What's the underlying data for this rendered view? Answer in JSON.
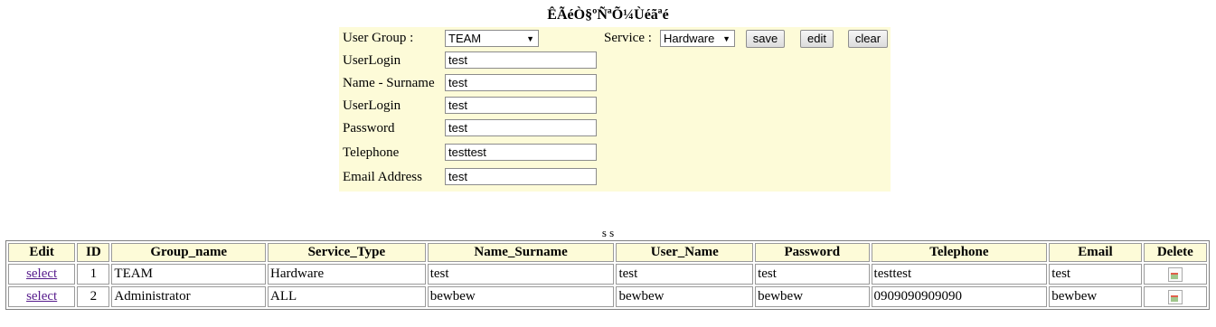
{
  "page_title": "ÊÃéÒ§ºÑªÕ¼Ùéãªé",
  "form": {
    "user_group_label": "User Group :",
    "user_group_value": "TEAM",
    "service_label": "Service :",
    "service_value": "Hardware",
    "buttons": {
      "save": "save",
      "edit": "edit",
      "clear": "clear"
    },
    "fields": [
      {
        "label": "UserLogin",
        "value": "test"
      },
      {
        "label": "Name - Surname",
        "value": "test"
      },
      {
        "label": "UserLogin",
        "value": "test"
      },
      {
        "label": "Password",
        "value": "test"
      },
      {
        "label": "Telephone",
        "value": "testtest"
      },
      {
        "label": "Email Address",
        "value": "test"
      }
    ]
  },
  "separator_text": "s s",
  "table": {
    "headers": [
      "Edit",
      "ID",
      "Group_name",
      "Service_Type",
      "Name_Surname",
      "User_Name",
      "Password",
      "Telephone",
      "Email",
      "Delete"
    ],
    "rows": [
      [
        "select",
        "1",
        "TEAM",
        "Hardware",
        "test",
        "test",
        "test",
        "testtest",
        "test",
        "broken-image-icon"
      ],
      [
        "select",
        "2",
        "Administrator",
        "ALL",
        "bewbew",
        "bewbew",
        "bewbew",
        "0909090909090",
        "bewbew",
        "broken-image-icon"
      ]
    ]
  }
}
